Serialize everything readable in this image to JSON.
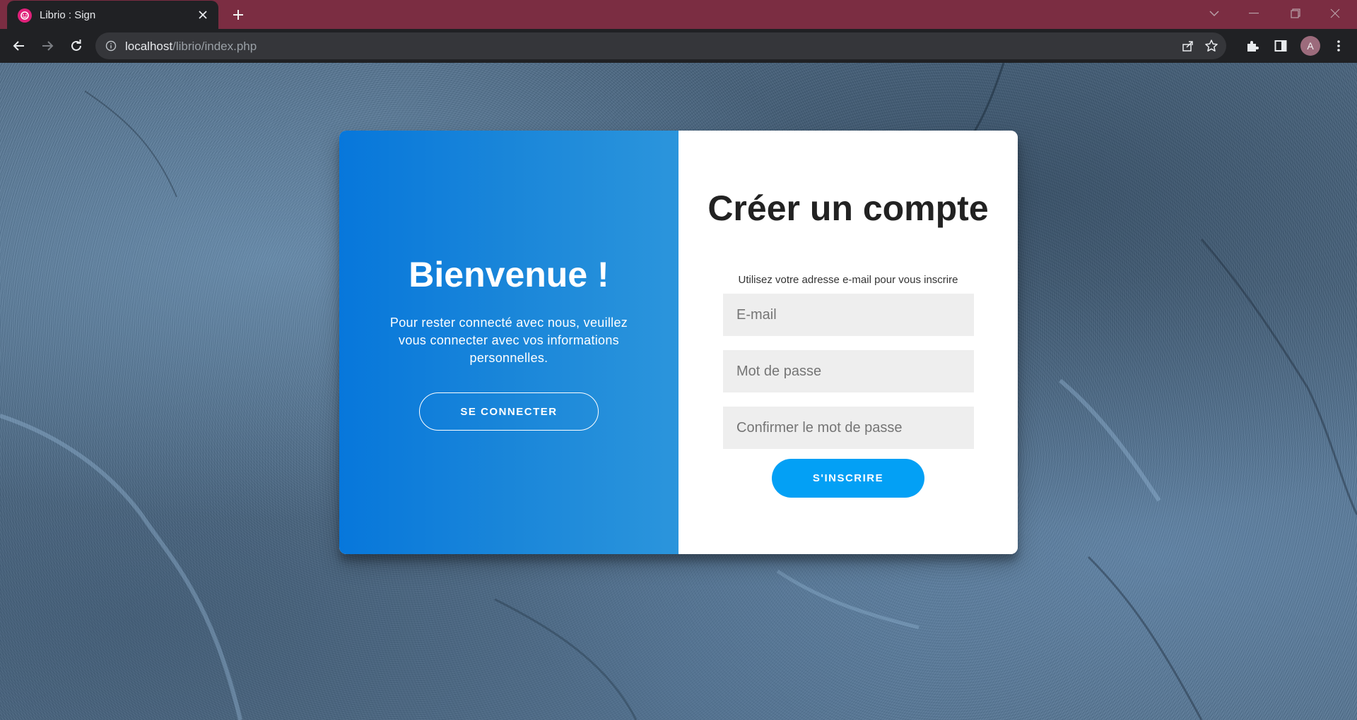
{
  "browser": {
    "tab_title": "Librio : Sign",
    "url_host": "localhost",
    "url_path": "/librio/index.php",
    "profile_initial": "A",
    "tabbar_color": "#7b2d42"
  },
  "icons": {
    "favicon": "librio-favicon",
    "tab_close": "close-icon",
    "new_tab": "plus-icon",
    "back": "arrow-left-icon",
    "forward": "arrow-right-icon",
    "reload": "reload-icon",
    "site_info": "info-icon",
    "share": "share-icon",
    "bookmark": "star-icon",
    "extensions": "puzzle-icon",
    "side_panel": "side-panel-icon",
    "menu": "kebab-menu-icon"
  },
  "welcome_panel": {
    "title": "Bienvenue !",
    "text": "Pour rester connecté avec nous, veuillez vous connecter avec vos informations personnelles.",
    "button_label": "SE CONNECTER",
    "gradient_start": "#0777db",
    "gradient_end": "#2b95dc"
  },
  "signup_panel": {
    "title": "Créer un compte",
    "subtitle": "Utilisez votre adresse e-mail pour vous inscrire",
    "email_placeholder": "E-mail",
    "password_placeholder": "Mot de passe",
    "confirm_placeholder": "Confirmer le mot de passe",
    "email_value": "",
    "password_value": "",
    "confirm_value": "",
    "button_label": "S'INSCRIRE",
    "button_color": "#03a0f5"
  }
}
